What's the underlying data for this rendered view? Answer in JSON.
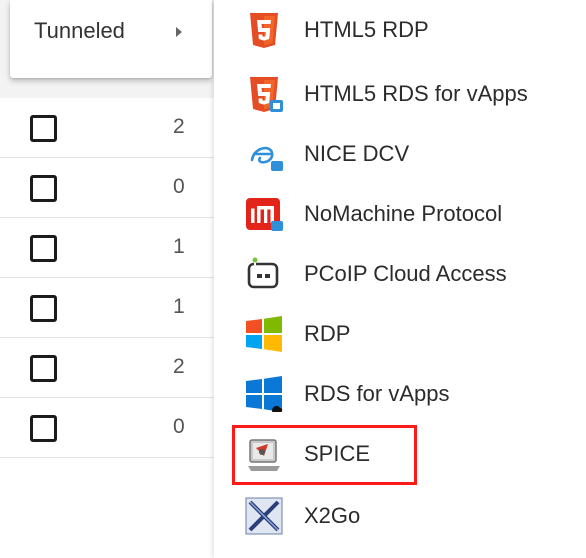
{
  "menu": {
    "tunneled_label": "Tunneled"
  },
  "table": {
    "rows": [
      {
        "count": "2"
      },
      {
        "count": "0"
      },
      {
        "count": "1"
      },
      {
        "count": "1"
      },
      {
        "count": "2"
      },
      {
        "count": "0"
      }
    ]
  },
  "submenu": {
    "items": [
      {
        "label": "HTML5 RDP",
        "icon": "html5-icon"
      },
      {
        "label": "HTML5 RDS for vApps",
        "icon": "html5-vapps-icon"
      },
      {
        "label": "NICE DCV",
        "icon": "nice-dcv-icon"
      },
      {
        "label": "NoMachine Protocol",
        "icon": "nomachine-icon"
      },
      {
        "label": "PCoIP Cloud Access",
        "icon": "pcoip-icon"
      },
      {
        "label": "RDP",
        "icon": "windows-icon"
      },
      {
        "label": "RDS for vApps",
        "icon": "windows-vapps-icon"
      },
      {
        "label": "SPICE",
        "icon": "spice-icon"
      },
      {
        "label": "X2Go",
        "icon": "x2go-icon"
      }
    ],
    "highlighted_item": "SPICE"
  },
  "colors": {
    "highlight": "#ff1a1a",
    "html5_orange": "#e44d26",
    "windows_blue": "#0a78d7"
  }
}
